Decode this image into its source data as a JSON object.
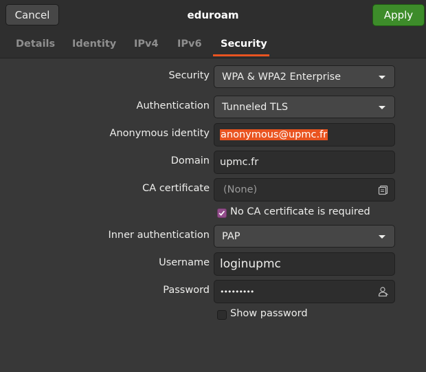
{
  "header": {
    "cancel_label": "Cancel",
    "title": "eduroam",
    "apply_label": "Apply"
  },
  "tabs": [
    {
      "label": "Details"
    },
    {
      "label": "Identity"
    },
    {
      "label": "IPv4"
    },
    {
      "label": "IPv6"
    },
    {
      "label": "Security",
      "active": true
    }
  ],
  "form": {
    "security": {
      "label": "Security",
      "value": "WPA & WPA2 Enterprise"
    },
    "authentication": {
      "label": "Authentication",
      "value": "Tunneled TLS"
    },
    "anonymous_identity": {
      "label": "Anonymous identity",
      "value": "anonymous@upmc.fr"
    },
    "domain": {
      "label": "Domain",
      "value": "upmc.fr"
    },
    "ca_certificate": {
      "label": "CA certificate",
      "value": "(None)"
    },
    "no_ca_required": {
      "label": "No CA certificate is required",
      "checked": true
    },
    "inner_authentication": {
      "label": "Inner authentication",
      "value": "PAP"
    },
    "username": {
      "label": "Username",
      "value": "loginupmc"
    },
    "password": {
      "label": "Password",
      "value": "•••••••••"
    },
    "show_password": {
      "label": "Show password",
      "checked": false
    }
  },
  "colors": {
    "accent": "#e95420",
    "apply_green": "#3d8c2a",
    "checkbox_purple": "#924d8b"
  },
  "icons": {
    "ca_certificate_icon": "document-open-icon",
    "password_icon": "user-icon",
    "combo_arrow": "pan-down-icon"
  }
}
